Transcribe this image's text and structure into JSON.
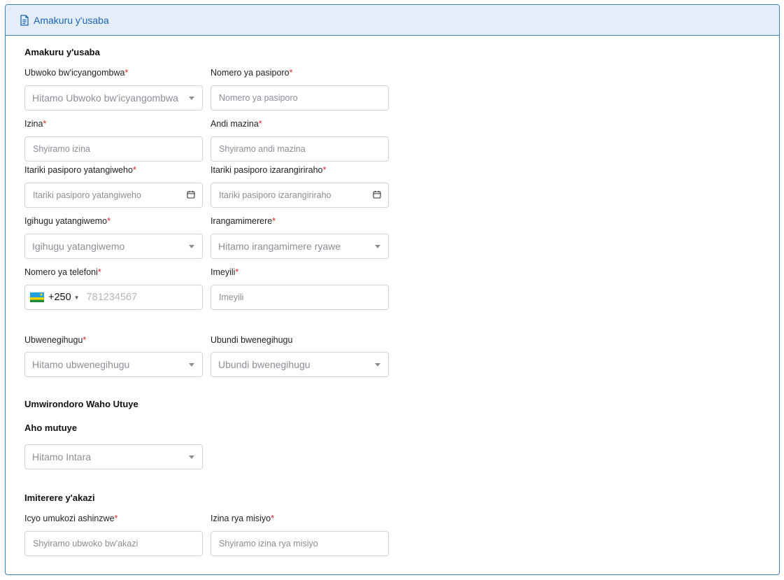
{
  "header": {
    "title": "Amakuru y'usaba",
    "icon": "document-icon"
  },
  "sections": {
    "applicant": "Amakuru y'usaba",
    "address": "Umwirondoro Waho Utuye",
    "residence": "Aho mutuye",
    "work": "Imiterere y'akazi"
  },
  "fields": {
    "permit_type": {
      "label": "Ubwoko bw'icyangombwa",
      "placeholder": "Hitamo Ubwoko bw'icyangombwa"
    },
    "passport_number": {
      "label": "Nomero ya pasiporo",
      "placeholder": "Nomero ya pasiporo"
    },
    "first_name": {
      "label": "Izina",
      "placeholder": "Shyiramo izina"
    },
    "other_names": {
      "label": "Andi mazina",
      "placeholder": "Shyiramo andi mazina"
    },
    "passport_issue_date": {
      "label": "Itariki pasiporo yatangiweho",
      "placeholder": "Itariki pasiporo yatangiweho"
    },
    "passport_expiry_date": {
      "label": "Itariki pasiporo izarangiriraho",
      "placeholder": "Itariki pasiporo izarangiriraho"
    },
    "issuing_country": {
      "label": "Igihugu yatangiwemo",
      "placeholder": "Igihugu yatangiwemo"
    },
    "gender": {
      "label": "Irangamimerere",
      "placeholder": "Hitamo irangamimere ryawe"
    },
    "phone": {
      "label": "Nomero ya telefoni",
      "code": "+250",
      "placeholder": "781234567"
    },
    "email": {
      "label": "Imeyili",
      "placeholder": "Imeyili"
    },
    "nationality": {
      "label": "Ubwenegihugu",
      "placeholder": "Hitamo ubwenegihugu"
    },
    "other_nationality": {
      "label": "Ubundi bwenegihugu",
      "placeholder": "Ubundi bwenegihugu"
    },
    "province": {
      "placeholder": "Hitamo Intara"
    },
    "occupation": {
      "label": "Icyo umukozi ashinzwe",
      "placeholder": "Shyiramo ubwoko bw'akazi"
    },
    "mission_name": {
      "label": "Izina rya misiyo",
      "placeholder": "Shyiramo izina rya misiyo"
    }
  },
  "required_marker": "*",
  "colors": {
    "accent": "#1c63b7",
    "header_bg": "#e3eef9",
    "border": "#3f7fc4",
    "required": "#e02424"
  }
}
